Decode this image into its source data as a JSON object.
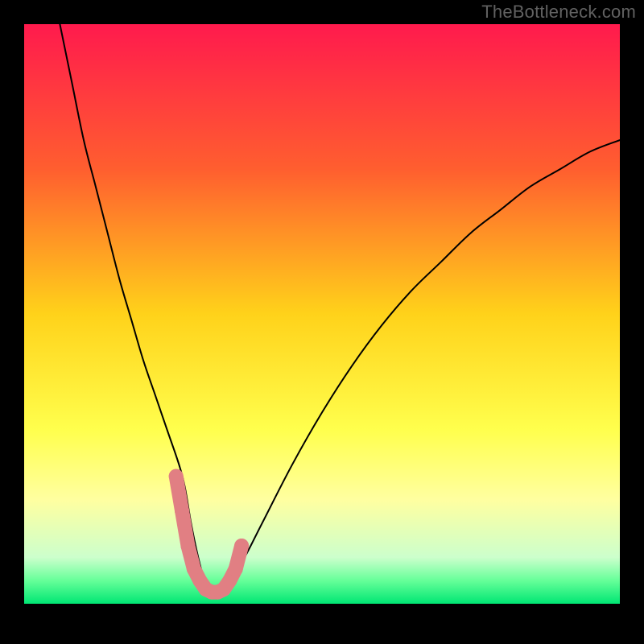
{
  "watermark": "TheBottleneck.com",
  "chart_data": {
    "type": "line",
    "title": "",
    "xlabel": "",
    "ylabel": "",
    "xlim": [
      0,
      100
    ],
    "ylim": [
      0,
      100
    ],
    "background_gradient": {
      "stops": [
        {
          "offset": 0.0,
          "color": "#ff1a4d"
        },
        {
          "offset": 0.25,
          "color": "#ff5e2f"
        },
        {
          "offset": 0.5,
          "color": "#ffd21a"
        },
        {
          "offset": 0.7,
          "color": "#ffff4d"
        },
        {
          "offset": 0.82,
          "color": "#ffffa0"
        },
        {
          "offset": 0.92,
          "color": "#ccffcc"
        },
        {
          "offset": 0.96,
          "color": "#66ff99"
        },
        {
          "offset": 1.0,
          "color": "#00e673"
        }
      ]
    },
    "series": [
      {
        "name": "bottleneck-curve",
        "color": "#000000",
        "width": 2,
        "x": [
          6,
          8,
          10,
          12,
          14,
          16,
          18,
          20,
          22,
          24,
          26,
          27,
          28,
          29,
          30,
          31,
          32,
          33,
          35,
          37,
          40,
          45,
          50,
          55,
          60,
          65,
          70,
          75,
          80,
          85,
          90,
          95,
          100
        ],
        "values": [
          100,
          90,
          80,
          72,
          64,
          56,
          49,
          42,
          36,
          30,
          24,
          20,
          14,
          9,
          5,
          3,
          2,
          3,
          5,
          8,
          14,
          24,
          33,
          41,
          48,
          54,
          59,
          64,
          68,
          72,
          75,
          78,
          80
        ]
      }
    ],
    "highlight_band": {
      "name": "minimum-region",
      "color": "#e17f83",
      "radius": 9,
      "points_x": [
        25.5,
        26.5,
        27.5,
        28.5,
        29.5,
        30.5,
        31.5,
        32.5,
        33.5,
        34.5,
        35.5,
        36.5
      ],
      "points_y": [
        22,
        16,
        10,
        6,
        4,
        2.5,
        2,
        2,
        2.5,
        4,
        6,
        10
      ]
    }
  }
}
